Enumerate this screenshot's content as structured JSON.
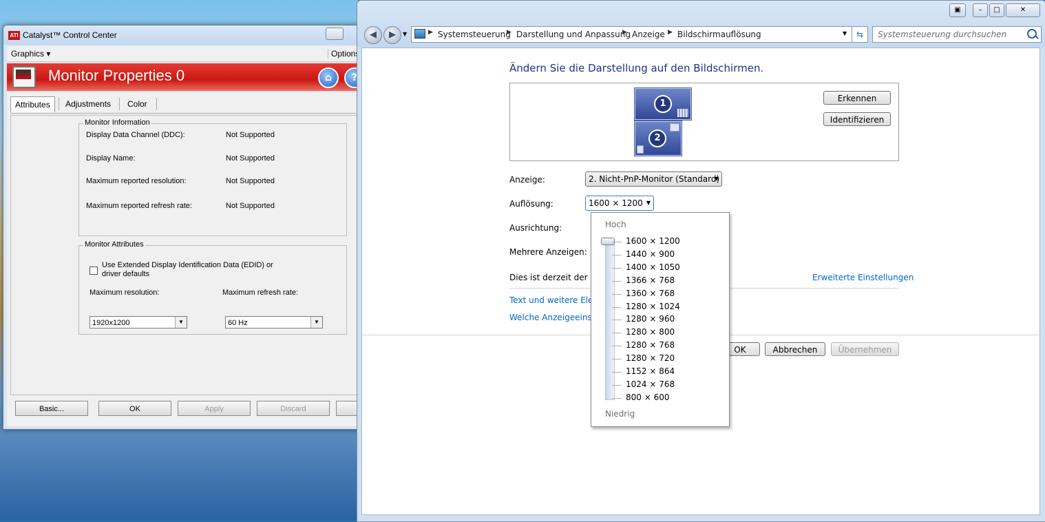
{
  "ati": {
    "title": "Catalyst™ Control Center",
    "logo_text": "ATI",
    "menu_graphics": "Graphics ▾",
    "menu_options": "Options",
    "banner_title": "Monitor Properties 0",
    "home_icon": "house-icon",
    "help_icon": "help-icon",
    "tabs": [
      "Attributes",
      "Adjustments",
      "Color"
    ],
    "monitor_info": {
      "legend": "Monitor Information",
      "rows": [
        {
          "label": "Display Data Channel (DDC):",
          "value": "Not Supported"
        },
        {
          "label": "Display Name:",
          "value": "Not Supported"
        },
        {
          "label": "Maximum reported resolution:",
          "value": "Not Supported"
        },
        {
          "label": "Maximum reported refresh rate:",
          "value": "Not Supported"
        }
      ]
    },
    "monitor_attr": {
      "legend": "Monitor Attributes",
      "edid_label_1": "Use Extended Display Identification Data (EDID) or",
      "edid_label_2": "driver defaults",
      "max_res_label": "Maximum resolution:",
      "max_refresh_label": "Maximum refresh rate:",
      "max_res_value": "1920x1200",
      "max_refresh_value": "60 Hz"
    },
    "buttons": {
      "basic": "Basic...",
      "ok": "OK",
      "apply": "Apply",
      "discard": "Discard"
    }
  },
  "cp": {
    "breadcrumb": [
      "Systemsteuerung",
      "Darstellung und Anpassung",
      "Anzeige",
      "Bildschirmauflösung"
    ],
    "search_placeholder": "Systemsteuerung durchsuchen",
    "heading": "Ändern Sie die Darstellung auf den Bildschirmen.",
    "monitor1": "1",
    "monitor2": "2",
    "detect_button": "Erkennen",
    "identify_button": "Identifizieren",
    "display_label": "Anzeige:",
    "display_value": "2. Nicht-PnP-Monitor (Standard)",
    "resolution_label": "Auflösung:",
    "resolution_value": "1600 × 1200",
    "orientation_label": "Ausrichtung:",
    "multiple_label": "Mehrere Anzeigen:",
    "primary_text": "Dies ist derzeit der Ha",
    "advanced_link": "Erweiterte Einstellungen",
    "link_text_size": "Text und weitere Elen",
    "link_which": "Welche Anzeigeeinste",
    "ok_button": "OK",
    "cancel_button": "Abbrechen",
    "apply_button": "Übernehmen",
    "dropdown": {
      "high_label": "Hoch",
      "low_label": "Niedrig",
      "selected": "1600 × 1200",
      "options": [
        "1600 × 1200",
        "1440 × 900",
        "1400 × 1050",
        "1366 × 768",
        "1360 × 768",
        "1280 × 1024",
        "1280 × 960",
        "1280 × 800",
        "1280 × 768",
        "1280 × 720",
        "1152 × 864",
        "1024 × 768",
        "800 × 600"
      ]
    }
  }
}
